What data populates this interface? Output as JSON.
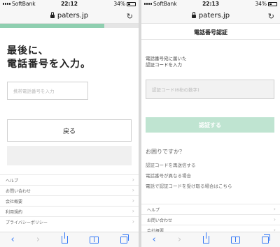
{
  "left": {
    "status": {
      "carrier": "SoftBank",
      "time": "22:12",
      "battery": "34%"
    },
    "url": "paters.jp",
    "progress_fraction": 0.75,
    "headline": "最後に、\n電話番号を入力。",
    "phone_placeholder": "携帯電話番号を入力",
    "back_label": "戻る",
    "menu": [
      "ヘルプ",
      "お問い合わせ",
      "会社概要",
      "利用規約",
      "プライバシーポリシー"
    ]
  },
  "right": {
    "status": {
      "carrier": "SoftBank",
      "time": "22:13",
      "battery": "34%"
    },
    "url": "paters.jp",
    "title": "電話番号認証",
    "instructions": "電話番号宛に届いた\n認証コードを入力",
    "code_placeholder": "認証コード(6桁の数字)",
    "submit_label": "認証する",
    "help_heading": "お困りですか？",
    "help_links": [
      "認証コードを再送信する",
      "電話番号が異なる場合",
      "電話で認証コードを受け取る場合はこちら"
    ],
    "menu": [
      "ヘルプ",
      "お問い合わせ",
      "会社概要"
    ]
  },
  "colors": {
    "accent_green": "#8fcfb0",
    "button_green_disabled": "#bfe4d1",
    "ios_blue": "#3478f6"
  },
  "icons": [
    "lock-icon",
    "reload-icon",
    "back-arrow-icon",
    "forward-arrow-icon",
    "share-icon",
    "bookmarks-icon",
    "tabs-icon",
    "chevron-right-icon"
  ]
}
